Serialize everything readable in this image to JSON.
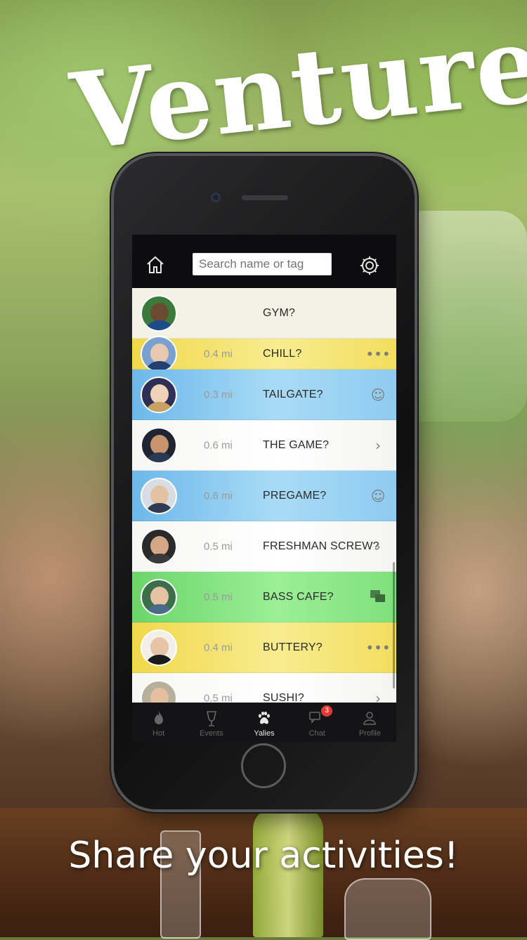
{
  "app": {
    "brand": "Venture",
    "tagline": "Share your activities!"
  },
  "header": {
    "home_icon": "home-icon",
    "search": {
      "placeholder": "Search name or tag",
      "value": ""
    },
    "settings_icon": "gear-icon"
  },
  "colors": {
    "blue_row": "#8ecbf0",
    "yellow_row": "#f2de5e",
    "white_row": "#ffffff",
    "green_row": "#7fe07b",
    "badge": "#e53935"
  },
  "activities": [
    {
      "distance": "",
      "title": "GYM?",
      "color": "cream",
      "action_icon": ""
    },
    {
      "distance": "0.4 mi",
      "title": "CHILL?",
      "color": "yellow",
      "action_icon": "more-icon"
    },
    {
      "distance": "0.3 mi",
      "title": "TAILGATE?",
      "color": "blue",
      "action_icon": "smiley-icon"
    },
    {
      "distance": "0.6 mi",
      "title": "THE GAME?",
      "color": "white",
      "action_icon": "chevron-right-icon"
    },
    {
      "distance": "0.6 mi",
      "title": "PREGAME?",
      "color": "blue",
      "action_icon": "smiley-icon"
    },
    {
      "distance": "0.5 mi",
      "title": "FRESHMAN SCREW?",
      "color": "white",
      "action_icon": "chevron-right-icon"
    },
    {
      "distance": "0.5 mi",
      "title": "BASS CAFE?",
      "color": "green",
      "action_icon": "chat-bubbles-icon"
    },
    {
      "distance": "0.4 mi",
      "title": "BUTTERY?",
      "color": "yellow",
      "action_icon": "more-icon"
    },
    {
      "distance": "0.5 mi",
      "title": "SUSHI?",
      "color": "white",
      "action_icon": "chevron-right-icon"
    }
  ],
  "tabs": [
    {
      "label": "Hot",
      "icon": "flame-icon"
    },
    {
      "label": "Events",
      "icon": "glass-icon"
    },
    {
      "label": "Yalies",
      "icon": "paw-icon",
      "active": true
    },
    {
      "label": "Chat",
      "icon": "chat-icon",
      "badge": "3"
    },
    {
      "label": "Profile",
      "icon": "person-icon"
    }
  ]
}
